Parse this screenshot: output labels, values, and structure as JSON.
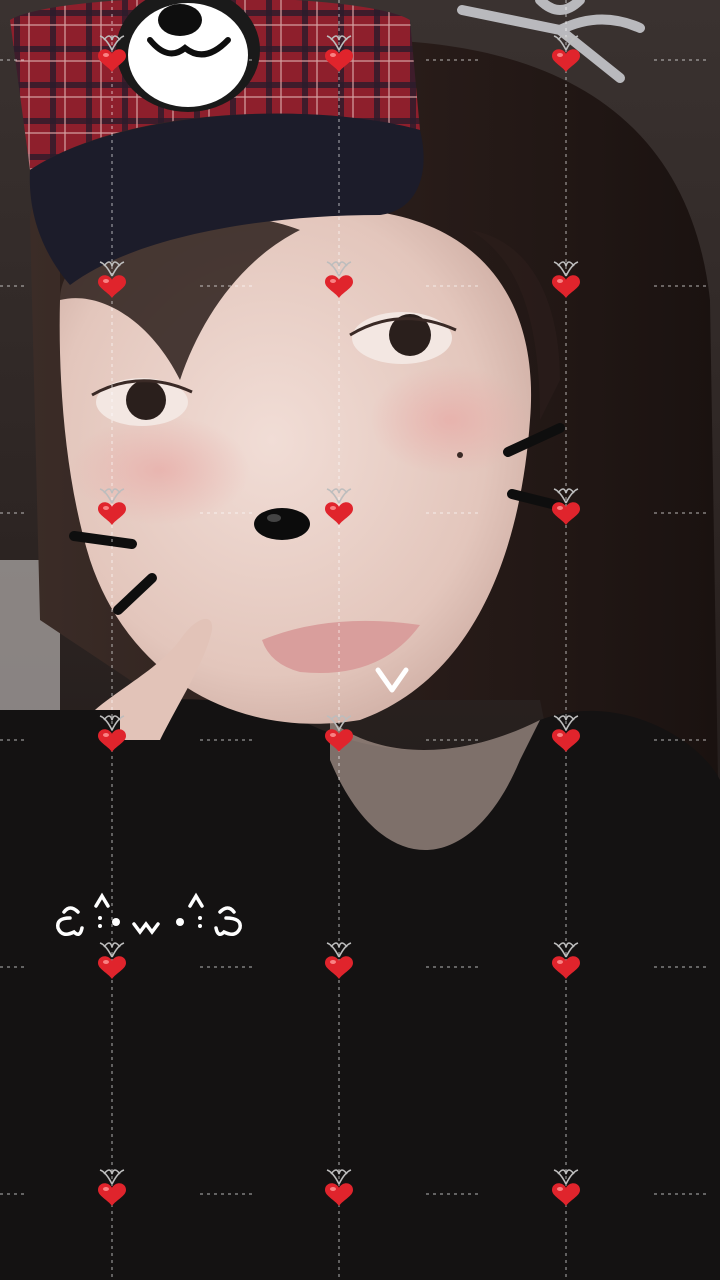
{
  "photo": {
    "subject": "selfie-with-cute-filter",
    "filter_stickers": [
      "bear-cap",
      "bow-ribbon",
      "cat-whiskers",
      "nose-sticker",
      "kaomoji-doodle",
      "chevron-doodle"
    ],
    "heart_grid": {
      "columns": 3,
      "rows": 6,
      "icon": "cherry-heart-icon"
    },
    "colors": {
      "background": "#1a1616",
      "skin": "#e8cfc6",
      "hair": "#2a1d1a",
      "shirt": "#151313",
      "cap_plaid": "#9b2432",
      "cap_brim": "#1c1c2a",
      "heart": "#e0242c",
      "lips": "#d69a98",
      "doodle": "#ffffff"
    }
  }
}
